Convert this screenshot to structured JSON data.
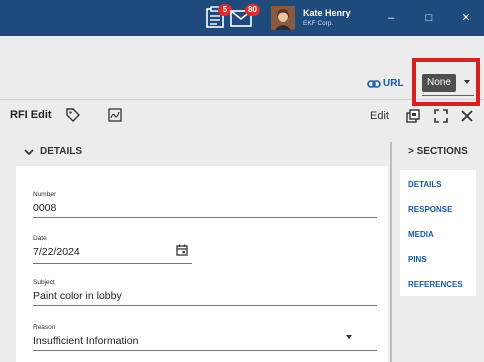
{
  "titlebar": {
    "tasks_badge": "5",
    "mail_badge": "80",
    "user_name": "Kate Henry",
    "user_company": "EKF Corp.",
    "minimize": "–",
    "maximize": "□",
    "close": "✕"
  },
  "toolbar": {
    "url_label": "URL",
    "select_value": "None"
  },
  "rfi": {
    "title": "RFI Edit",
    "edit_label": "Edit"
  },
  "details": {
    "heading": "DETAILS",
    "fields": [
      {
        "label": "Number",
        "value": "0008"
      },
      {
        "label": "Date",
        "value": "7/22/2024"
      },
      {
        "label": "Subject",
        "value": "Paint color in lobby"
      },
      {
        "label": "Reason",
        "value": "Insufficient Information"
      }
    ]
  },
  "sections": {
    "heading": "> SECTIONS",
    "items": [
      "DETAILS",
      "RESPONSE",
      "MEDIA",
      "PINS",
      "REFERENCES"
    ]
  },
  "colors": {
    "titlebar": "#1e4a7c",
    "accent": "#1a5aa6",
    "highlight": "#d92020",
    "badge": "#e02b2b"
  },
  "icons": [
    "tasks-icon",
    "mail-icon",
    "link-icon",
    "tag-icon",
    "sign-icon",
    "export-icon",
    "expand-icon",
    "close-icon",
    "chevron-down-icon",
    "calendar-icon",
    "dropdown-arrow-icon"
  ]
}
